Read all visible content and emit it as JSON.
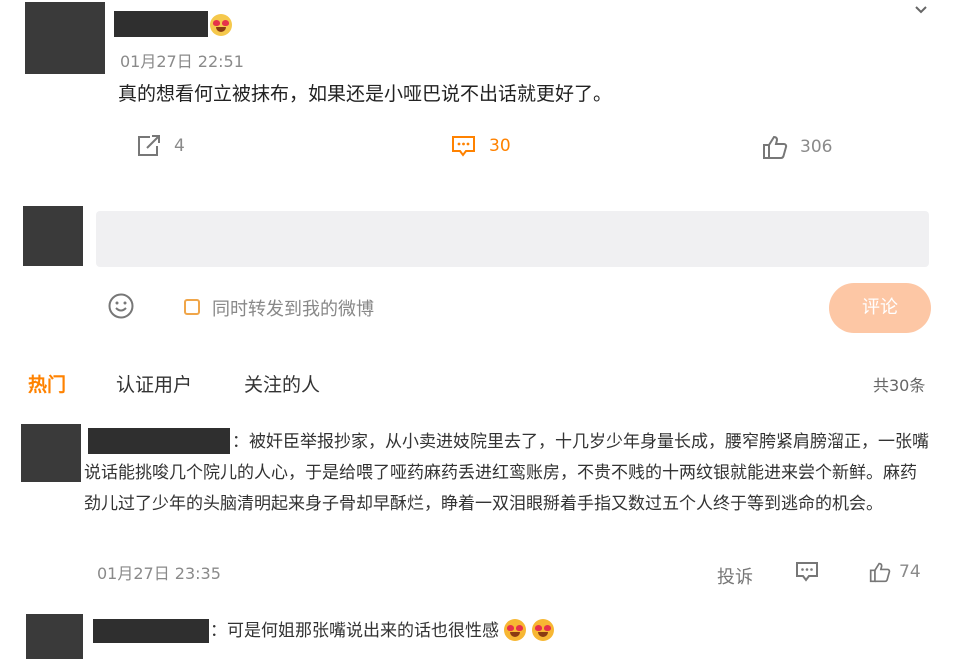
{
  "post": {
    "time": "01月27日 22:51",
    "text": "真的想看何立被抹布，如果还是小哑巴说不出话就更好了。",
    "actions": {
      "repost_count": "4",
      "comment_count": "30",
      "like_count": "306"
    }
  },
  "composer": {
    "placeholder": "",
    "repost_label": "同时转发到我的微博",
    "submit_label": "评论"
  },
  "tabs": {
    "hot": "热门",
    "verified": "认证用户",
    "following": "关注的人",
    "total": "共30条"
  },
  "comments": [
    {
      "text": "：被奸臣举报抄家，从小卖进妓院里去了，十几岁少年身量长成，腰窄胯紧肩膀溜正，一张嘴说话能挑唆几个院儿的人心，于是给喂了哑药麻药丢进红鸾账房，不贵不贱的十两纹银就能进来尝个新鲜。麻药劲儿过了少年的头脑清明起来身子骨却早酥烂，睁着一双泪眼掰着手指又数过五个人终于等到逃命的机会。",
      "time": "01月27日 23:35",
      "report_label": "投诉",
      "like_count": "74"
    },
    {
      "text": "：可是何姐那张嘴说出来的话也很性感"
    }
  ],
  "colors": {
    "accent": "#ff8200",
    "submit_bg": "#fdc7a5",
    "redaction": "#2f2f2f"
  }
}
